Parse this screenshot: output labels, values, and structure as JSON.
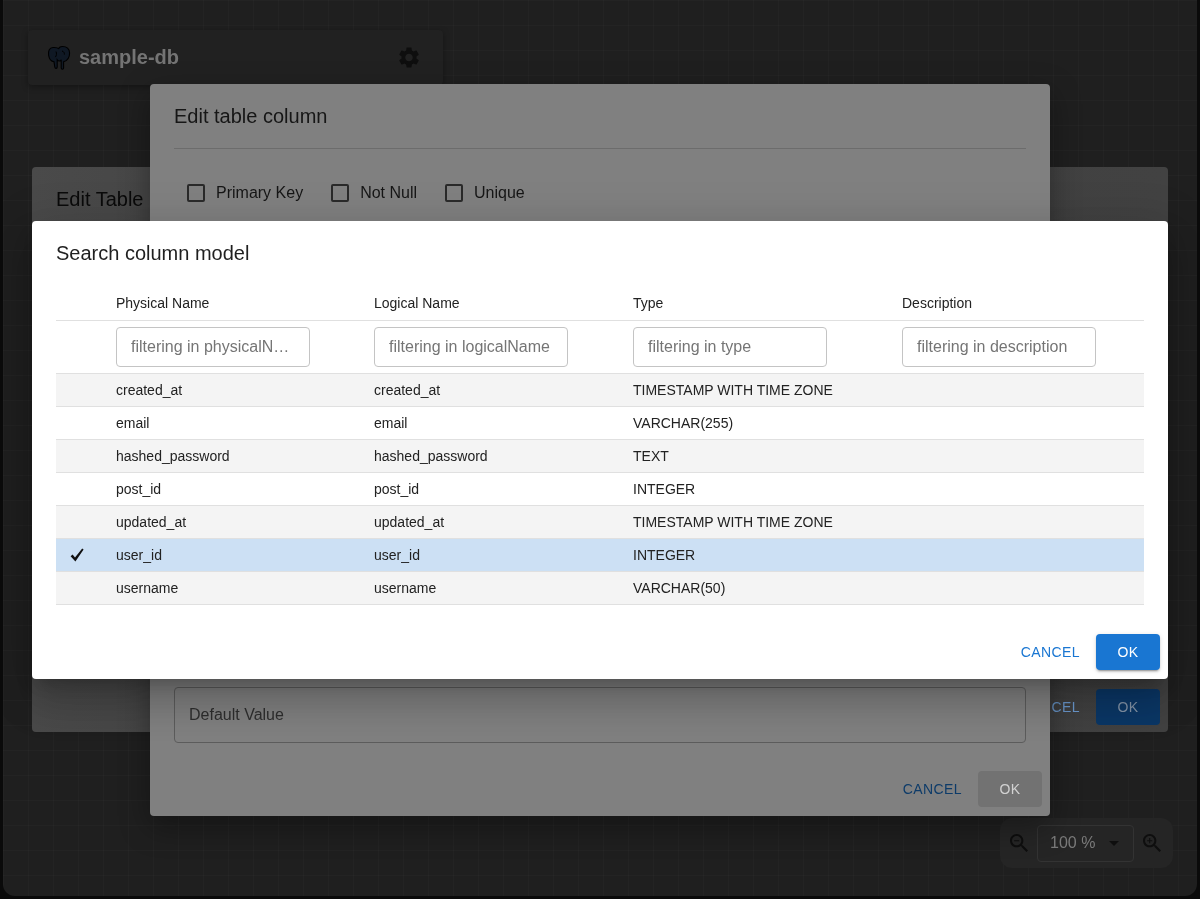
{
  "app": {
    "title": "sample-db"
  },
  "zoom": {
    "value": "100 %"
  },
  "edit_table_dialog": {
    "title": "Edit Table",
    "buttons": [
      {
        "label": "CEL",
        "kind": "text"
      },
      {
        "label": "OK",
        "kind": "contained"
      }
    ]
  },
  "edit_column_dialog": {
    "title": "Edit table column",
    "options": [
      {
        "label": "Primary Key",
        "checked": false
      },
      {
        "label": "Not Null",
        "checked": false
      },
      {
        "label": "Unique",
        "checked": false
      }
    ],
    "default_value": {
      "placeholder": "Default Value"
    },
    "buttons": [
      {
        "label": "CANCEL",
        "kind": "text",
        "disabled": false
      },
      {
        "label": "OK",
        "kind": "contained",
        "disabled": true
      }
    ]
  },
  "search_dialog": {
    "title": "Search column model",
    "table": {
      "columns": [
        "Physical Name",
        "Logical Name",
        "Type",
        "Description"
      ],
      "filters": [
        {
          "placeholder": "filtering in physicalN…"
        },
        {
          "placeholder": "filtering in logicalName"
        },
        {
          "placeholder": "filtering in type"
        },
        {
          "placeholder": "filtering in description"
        }
      ],
      "rows": [
        {
          "physical_name": "created_at",
          "logical_name": "created_at",
          "type": "TIMESTAMP WITH TIME ZONE",
          "selected": false
        },
        {
          "physical_name": "email",
          "logical_name": "email",
          "type": "VARCHAR(255)",
          "selected": false
        },
        {
          "physical_name": "hashed_password",
          "logical_name": "hashed_password",
          "type": "TEXT",
          "selected": false
        },
        {
          "physical_name": "post_id",
          "logical_name": "post_id",
          "type": "INTEGER",
          "selected": false
        },
        {
          "physical_name": "updated_at",
          "logical_name": "updated_at",
          "type": "TIMESTAMP WITH TIME ZONE",
          "selected": false
        },
        {
          "physical_name": "user_id",
          "logical_name": "user_id",
          "type": "INTEGER",
          "selected": true
        },
        {
          "physical_name": "username",
          "logical_name": "username",
          "type": "VARCHAR(50)",
          "selected": false
        }
      ]
    },
    "buttons": [
      {
        "label": "CANCEL",
        "kind": "text"
      },
      {
        "label": "OK",
        "kind": "contained"
      }
    ]
  }
}
